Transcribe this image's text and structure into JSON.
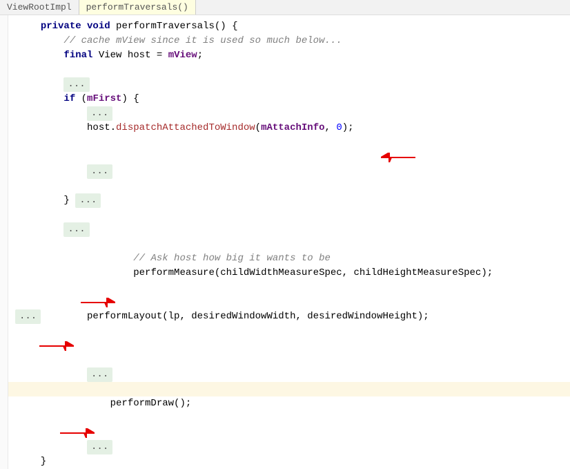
{
  "breadcrumb": {
    "class_name": "ViewRootImpl",
    "method_name": "performTraversals()"
  },
  "code": {
    "kw_private": "private",
    "kw_void": "void",
    "method_decl": "performTraversals",
    "comment_cache": "// cache mView since it is used so much below...",
    "kw_final": "final",
    "type_view": "View",
    "var_host": "host",
    "var_mview": "mView",
    "kw_if": "if",
    "var_mfirst": "mFirst",
    "call_dispatch": "dispatchAttachedToWindow",
    "var_attachinfo": "mAttachInfo",
    "num_zero": "0",
    "comment_ask": "// Ask host how big it wants to be",
    "call_measure": "performMeasure(childWidthMeasureSpec, childHeightMeasureSpec);",
    "call_layout": "performLayout(lp, desiredWindowWidth, desiredWindowHeight);",
    "call_draw": "performDraw();",
    "fold": "..."
  }
}
